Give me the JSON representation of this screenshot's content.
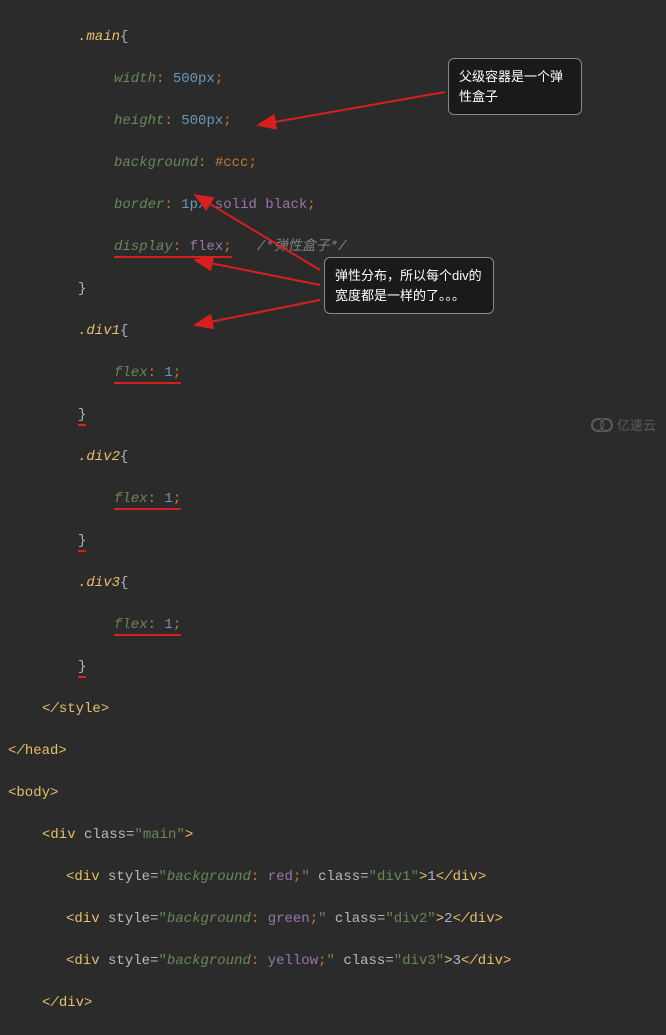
{
  "css": {
    "main_selector": ".main",
    "main_props": {
      "width_label": "width",
      "width_val": "500px",
      "height_label": "height",
      "height_val": "500px",
      "background_label": "background",
      "background_val": "#ccc",
      "border_label": "border",
      "border_val": "1px solid black",
      "display_label": "display",
      "display_val": "flex"
    },
    "display_comment": "/*弹性盒子*/",
    "div1_selector": ".div1",
    "div2_selector": ".div2",
    "div3_selector": ".div3",
    "flex_label": "flex",
    "flex_val": "1"
  },
  "html_tags": {
    "style_close": "</style>",
    "head_close": "</head>",
    "body_open": "<body>",
    "div_open_main": "<div class=\"main\">",
    "div1": {
      "open_prefix": "<div style=\"",
      "style_prop": "background",
      "style_val": "red;",
      "close_attr": "\" class=\"div1\">",
      "text": "1",
      "close": "</div>"
    },
    "div2": {
      "open_prefix": "<div style=\"",
      "style_prop": "background",
      "style_val": "green;",
      "close_attr": "\" class=\"div2\">",
      "text": "2",
      "close": "</div>"
    },
    "div3": {
      "open_prefix": "<div style=\"",
      "style_prop": "background",
      "style_val": "yellow;",
      "close_attr": "\" class=\"div3\">",
      "text": "3",
      "close": "</div>"
    },
    "div_close": "</div>"
  },
  "annotations": {
    "box1": "父级容器是一个弹性盒子",
    "box2": "弹性分布，所以每个div的宽度都是一样的了。。。"
  },
  "watermark": "亿速云"
}
